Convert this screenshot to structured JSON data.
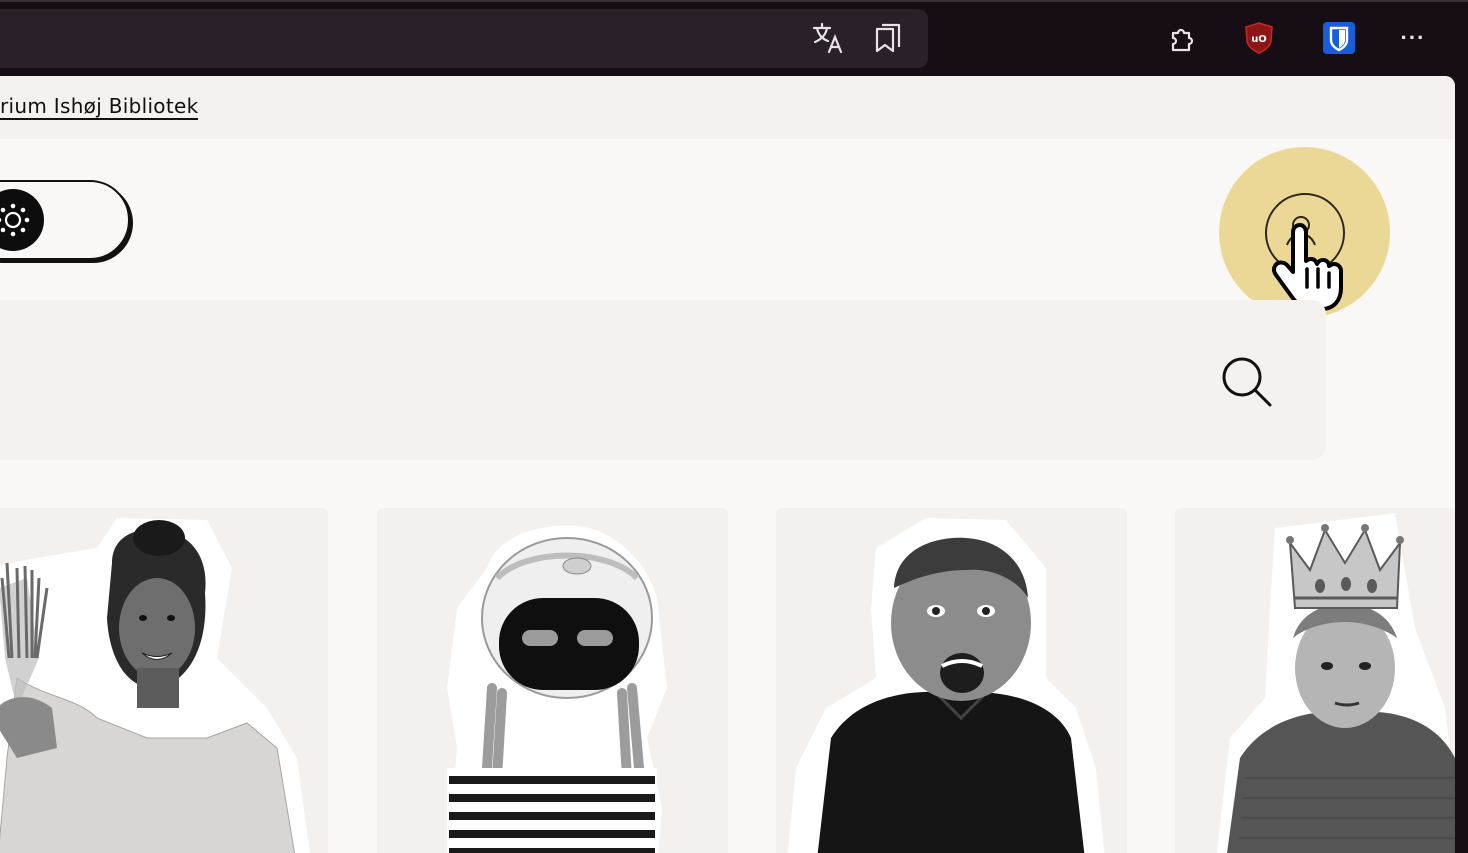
{
  "browser": {
    "toolbar_icons": [
      "translate-icon",
      "reading-list-icon",
      "extensions-icon",
      "ublock-icon",
      "bitwarden-icon",
      "more-icon"
    ],
    "ublock_badge": "uO",
    "more_glyph": "···"
  },
  "page": {
    "top_link": "urium Ishøj Bibliotek",
    "colors": {
      "background": "#faf8f6",
      "panel": "#f4f1ee",
      "accent": "#ecd896"
    }
  },
  "cards": [
    {
      "subject": "girl holding jar of paint brushes"
    },
    {
      "subject": "child wearing astronaut robot helmet"
    },
    {
      "subject": "boy shouting"
    },
    {
      "subject": "boy wearing crown"
    }
  ]
}
